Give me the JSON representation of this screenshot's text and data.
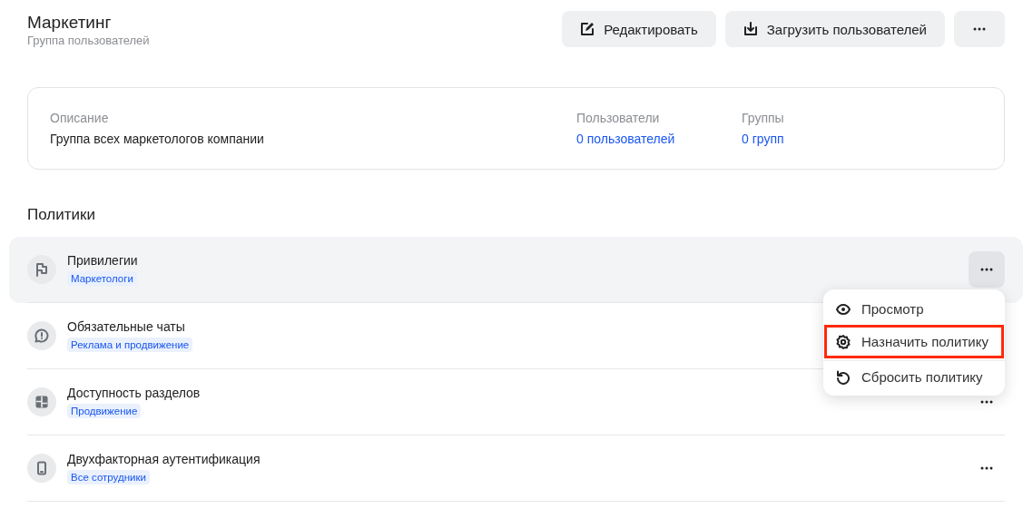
{
  "header": {
    "title": "Маркетинг",
    "subtitle": "Группа пользователей",
    "buttons": [
      {
        "kind": "edit",
        "label": "Редактировать"
      },
      {
        "kind": "upload",
        "label": "Загрузить пользователей"
      },
      {
        "kind": "more"
      }
    ]
  },
  "info": {
    "fields": [
      {
        "label": "Описание",
        "value": "Группа всех маркетологов компании",
        "kind": "text"
      },
      {
        "label": "Пользователи",
        "value": "0 пользователей",
        "kind": "link"
      },
      {
        "label": "Группы",
        "value": "0 групп",
        "kind": "link"
      }
    ]
  },
  "policies": {
    "title": "Политики",
    "rows": [
      {
        "kind": "flag",
        "name": "Привилегии",
        "tag": "Маркетологи",
        "hovered": true,
        "menu_open": true
      },
      {
        "kind": "alert",
        "name": "Обязательные чаты",
        "tag": "Реклама и продвижение",
        "hovered": false,
        "menu_open": false
      },
      {
        "kind": "grid",
        "name": "Доступность разделов",
        "tag": "Продвижение",
        "hovered": false,
        "menu_open": false
      },
      {
        "kind": "phone",
        "name": "Двухфакторная аутентификация",
        "tag": "Все сотрудники",
        "hovered": false,
        "menu_open": false
      }
    ]
  },
  "menu": {
    "items": [
      {
        "kind": "eye",
        "label": "Просмотр",
        "highlighted": false
      },
      {
        "kind": "gear",
        "label": "Назначить политику",
        "highlighted": true
      },
      {
        "kind": "reset",
        "label": "Сбросить политику",
        "highlighted": false
      }
    ]
  }
}
